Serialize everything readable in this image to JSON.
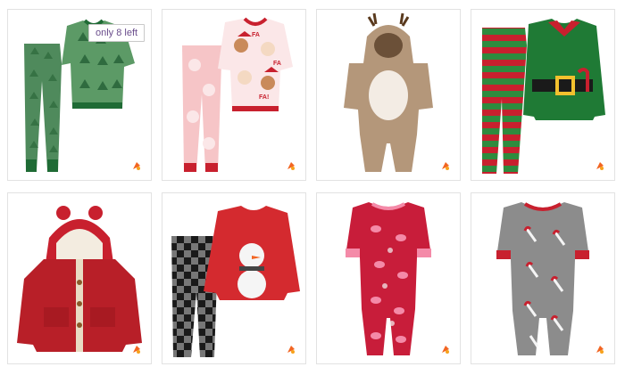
{
  "products": [
    {
      "name": "tree-print-pajama-set",
      "badge": "only 8 left"
    },
    {
      "name": "reindeer-santa-pajama-set"
    },
    {
      "name": "reindeer-hooded-jumpsuit"
    },
    {
      "name": "elf-pajama-set"
    },
    {
      "name": "red-sherpa-hooded-jacket"
    },
    {
      "name": "snowman-plaid-pajama-set"
    },
    {
      "name": "flamingo-footed-sleeper"
    },
    {
      "name": "candy-cane-footed-sleeper"
    }
  ],
  "colors": {
    "accent": "#f26522",
    "badge_text": "#6a4d8c"
  }
}
